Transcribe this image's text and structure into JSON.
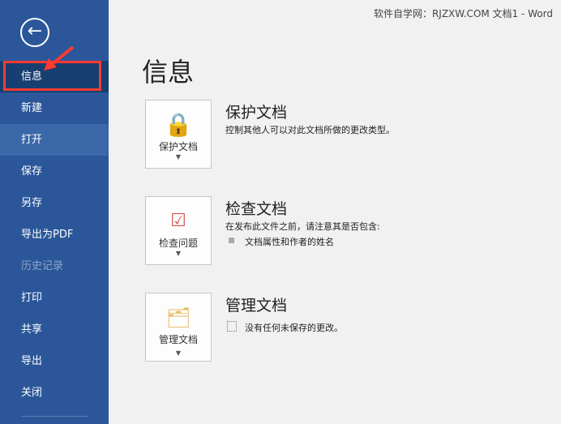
{
  "window_title": "软件自学网：RJZXW.COM 文档1  -  Word",
  "sidebar": {
    "items": [
      {
        "label": "信息"
      },
      {
        "label": "新建"
      },
      {
        "label": "打开"
      },
      {
        "label": "保存"
      },
      {
        "label": "另存"
      },
      {
        "label": "导出为PDF"
      },
      {
        "label": "历史记录"
      },
      {
        "label": "打印"
      },
      {
        "label": "共享"
      },
      {
        "label": "导出"
      },
      {
        "label": "关闭"
      }
    ]
  },
  "page_title": "信息",
  "sections": [
    {
      "button": "保护文档",
      "title": "保护文档",
      "desc": "控制其他人可以对此文档所做的更改类型。"
    },
    {
      "button": "检查问题",
      "title": "检查文档",
      "desc": "在发布此文件之前，请注意其是否包含:",
      "bullet": "文档属性和作者的姓名"
    },
    {
      "button": "管理文档",
      "title": "管理文档",
      "desc": "没有任何未保存的更改。"
    }
  ]
}
